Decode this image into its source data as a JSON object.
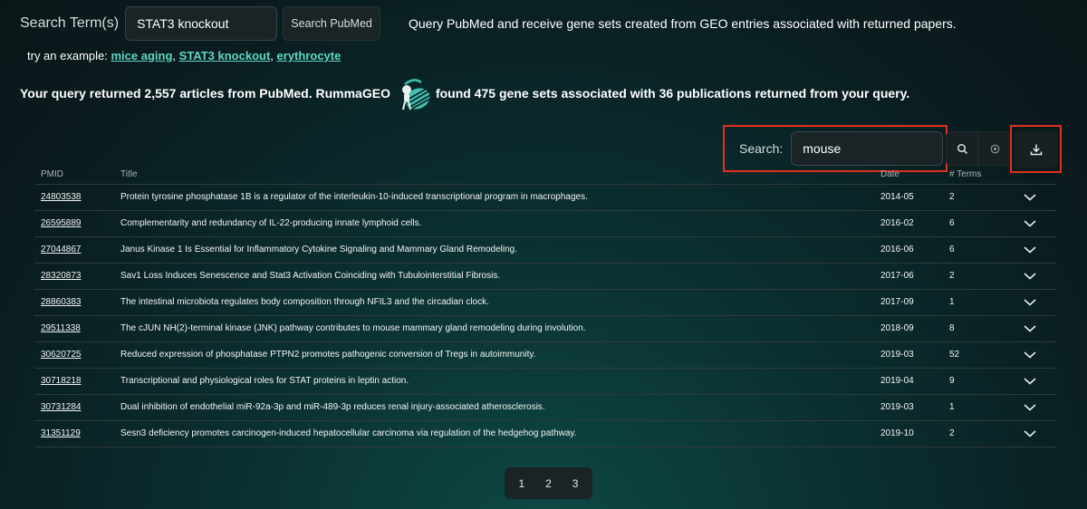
{
  "search": {
    "label": "Search Term(s)",
    "value": "STAT3 knockout",
    "button_label": "Search PubMed",
    "description": "Query PubMed and receive gene sets created from GEO entries associated with returned papers."
  },
  "examples": {
    "prefix": "try an example:",
    "items": [
      "mice aging",
      "STAT3 knockout",
      "erythrocyte"
    ]
  },
  "summary": {
    "part1": "Your query returned 2,557 articles from PubMed. RummaGEO",
    "part2": "found 475 gene sets associated with 36 publications returned from your query.",
    "logo_icon": "rummageo-logo"
  },
  "filter": {
    "label": "Search:",
    "value": "mouse",
    "search_icon": "search-icon",
    "clear_icon": "clear-icon",
    "download_icon": "download-icon"
  },
  "table": {
    "headers": [
      "PMID",
      "Title",
      "Date",
      "# Terms"
    ],
    "rows": [
      {
        "pmid": "24803538",
        "title": "Protein tyrosine phosphatase 1B is a regulator of the interleukin-10-induced transcriptional program in macrophages.",
        "date": "2014-05",
        "terms": "2"
      },
      {
        "pmid": "26595889",
        "title": "Complementarity and redundancy of IL-22-producing innate lymphoid cells.",
        "date": "2016-02",
        "terms": "6"
      },
      {
        "pmid": "27044867",
        "title": "Janus Kinase 1 Is Essential for Inflammatory Cytokine Signaling and Mammary Gland Remodeling.",
        "date": "2016-06",
        "terms": "6"
      },
      {
        "pmid": "28320873",
        "title": "Sav1 Loss Induces Senescence and Stat3 Activation Coinciding with Tubulointerstitial Fibrosis.",
        "date": "2017-06",
        "terms": "2"
      },
      {
        "pmid": "28860383",
        "title": "The intestinal microbiota regulates body composition through NFIL3 and the circadian clock.",
        "date": "2017-09",
        "terms": "1"
      },
      {
        "pmid": "29511338",
        "title": "The cJUN NH(2)-terminal kinase (JNK) pathway contributes to mouse mammary gland remodeling during involution.",
        "date": "2018-09",
        "terms": "8"
      },
      {
        "pmid": "30620725",
        "title": "Reduced expression of phosphatase PTPN2 promotes pathogenic conversion of Tregs in autoimmunity.",
        "date": "2019-03",
        "terms": "52"
      },
      {
        "pmid": "30718218",
        "title": "Transcriptional and physiological roles for STAT proteins in leptin action.",
        "date": "2019-04",
        "terms": "9"
      },
      {
        "pmid": "30731284",
        "title": "Dual inhibition of endothelial miR-92a-3p and miR-489-3p reduces renal injury-associated atherosclerosis.",
        "date": "2019-03",
        "terms": "1"
      },
      {
        "pmid": "31351129",
        "title": "Sesn3 deficiency promotes carcinogen-induced hepatocellular carcinoma via regulation of the hedgehog pathway.",
        "date": "2019-10",
        "terms": "2"
      }
    ]
  },
  "pagination": {
    "pages": [
      "1",
      "2",
      "3"
    ],
    "current": "1"
  },
  "colors": {
    "accent": "#5fd8c4",
    "highlight": "#e0301e",
    "background": "#0b2426"
  }
}
